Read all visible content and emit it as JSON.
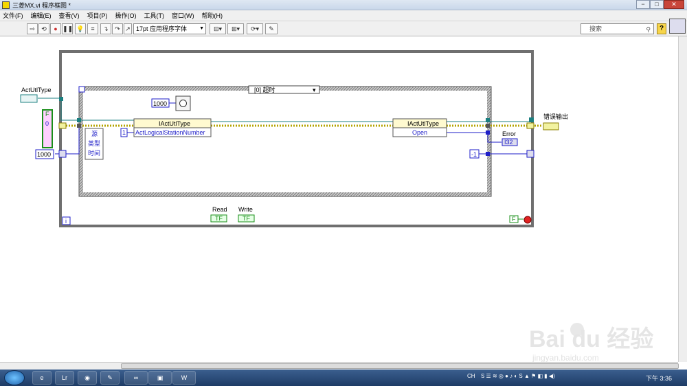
{
  "window": {
    "title": "三菱MX.vi 程序框图 *",
    "controls": [
      "−",
      "□",
      "✕"
    ]
  },
  "menu": [
    "文件(F)",
    "编辑(E)",
    "查看(V)",
    "项目(P)",
    "操作(O)",
    "工具(T)",
    "窗口(W)",
    "帮助(H)"
  ],
  "toolbar": {
    "font_select": "17pt 应用程序字体",
    "search_placeholder": "搜索",
    "help": "?"
  },
  "diagram": {
    "control_actutltype": "ActUtlType",
    "bool_f": "F",
    "numeric_0": "0",
    "const_1000_a": "1000",
    "const_1000_b": "1000",
    "case_selector": "[0] 超时",
    "node1_class": "IActUtlType",
    "node1_prop": "ActLogicalStationNumber",
    "const_1": "1",
    "event_source": "源",
    "event_type": "类型",
    "event_time": "时间",
    "node2_class": "IActUtlType",
    "node2_method": "Open",
    "error_label": "Error",
    "error_type": "I32",
    "const_neg1": "-1",
    "error_out_label": "错误输出",
    "read_label": "Read",
    "write_label": "Write",
    "tf": "TF",
    "loop_i": "i",
    "stop_f": "F"
  },
  "taskbar": {
    "tray_lang": "CH",
    "clock": "下午 3:36"
  },
  "watermark": {
    "brand": "Bai du 经验",
    "url": "jingyan.baidu.com"
  }
}
